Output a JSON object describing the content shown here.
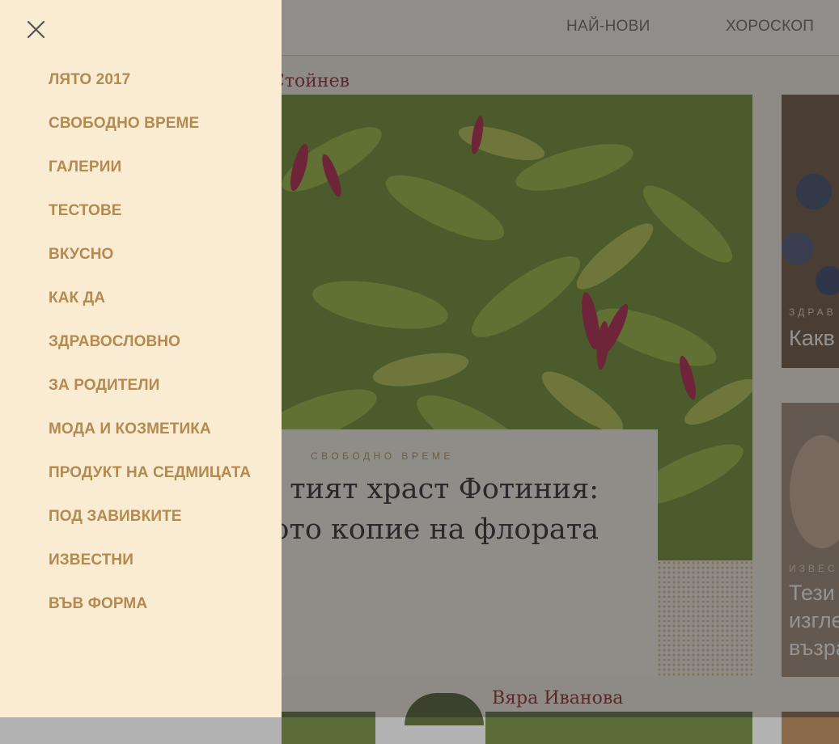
{
  "header": {
    "nav": [
      "НАЙ-НОВИ",
      "ХОРОСКОП"
    ]
  },
  "main": {
    "author_top": "Стойнев",
    "hero": {
      "category": "СВОБОДНО ВРЕМЕ",
      "title_line1": "тият храст Фотиния:",
      "title_line2": "ото копие на флората"
    },
    "side_cards": [
      {
        "category": "ЗДРАВ",
        "title": "Какв"
      },
      {
        "category": "ИЗВЕС",
        "title_lines": [
          "Тези",
          "изгле",
          "възра"
        ]
      }
    ],
    "author_bottom": "Вяра Иванова"
  },
  "drawer": {
    "close_icon": "close-icon",
    "items": [
      "ЛЯТО 2017",
      "СВОБОДНО ВРЕМЕ",
      "ГАЛЕРИИ",
      "ТЕСТОВЕ",
      "ВКУСНО",
      "КАК ДА",
      "ЗДРАВОСЛОВНО",
      "ЗА РОДИТЕЛИ",
      "МОДА И КОЗМЕТИКА",
      "ПРОДУКТ НА СЕДМИЦАТА",
      "ПОД ЗАВИВКИТЕ",
      "ИЗВЕСТНИ",
      "ВЪВ ФОРМА"
    ],
    "colors": {
      "background": "#f9ecd3",
      "item_text": "#b6894e"
    }
  }
}
